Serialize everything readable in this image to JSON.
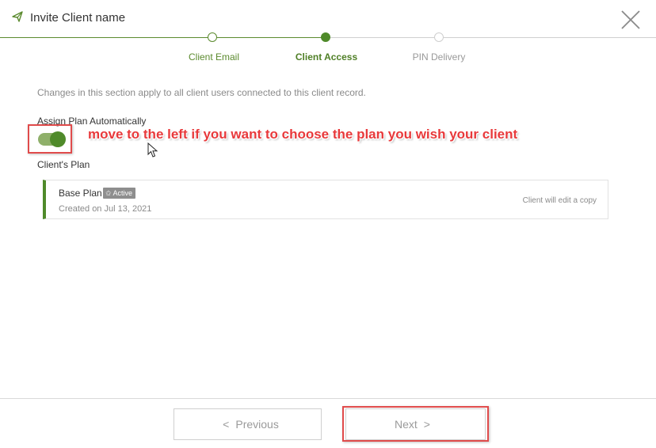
{
  "header": {
    "title": "Invite Client name",
    "icon": "send-icon",
    "close_icon": "close-icon"
  },
  "stepper": {
    "steps": [
      {
        "label": "Client Email",
        "state": "done"
      },
      {
        "label": "Client Access",
        "state": "current"
      },
      {
        "label": "PIN Delivery",
        "state": "upcoming"
      }
    ]
  },
  "content": {
    "intro": "Changes in this section apply to all client users connected to this client record.",
    "assign_label": "Assign Plan Automatically",
    "toggle_on": true,
    "annotation": "move to the left if you want to choose the plan you wish your client",
    "plan_section_label": "Client's Plan",
    "plan": {
      "name": "Base Plan",
      "badge": "Active",
      "badge_icon": "star-icon",
      "created": "Created on Jul 13, 2021",
      "note": "Client will edit a copy"
    }
  },
  "footer": {
    "previous_label": "Previous",
    "next_label": "Next"
  },
  "colors": {
    "accent": "#4f8a2a",
    "annotation_red": "#e8393b"
  }
}
